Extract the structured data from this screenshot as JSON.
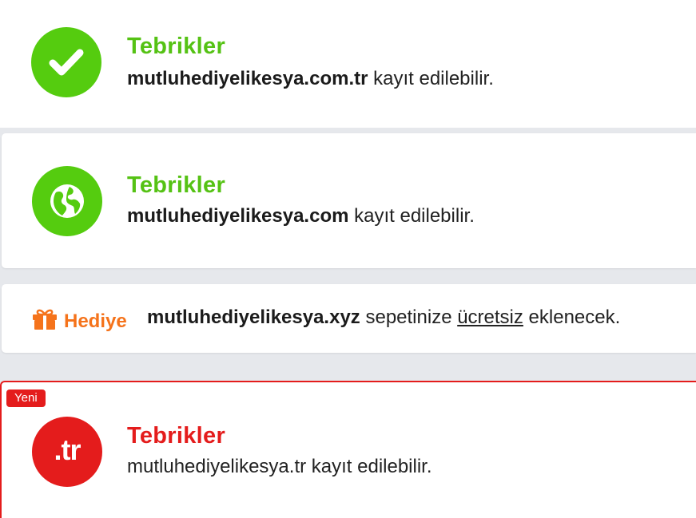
{
  "results": [
    {
      "icon": "check-icon",
      "title": "Tebrikler",
      "domain": "mutluhediyelikesya.com.tr",
      "suffix": " kayıt edilebilir."
    },
    {
      "icon": "globe-icon",
      "title": "Tebrikler",
      "domain": "mutluhediyelikesya.com",
      "suffix": " kayıt edilebilir."
    }
  ],
  "gift": {
    "icon": "gift-icon",
    "label": "Hediye",
    "domain": "mutluhediyelikesya.xyz",
    "text_before": " sepetinize ",
    "free_word": "ücretsiz",
    "text_after": " eklenecek."
  },
  "new_result": {
    "badge": "Yeni",
    "circle_text": ".tr",
    "title": "Tebrikler",
    "text": "mutluhediyelikesya.tr kayıt edilebilir."
  },
  "colors": {
    "success_green": "#55cc0f",
    "gift_orange": "#f5731b",
    "new_red": "#e41c1c",
    "background": "#e6e8ec"
  }
}
